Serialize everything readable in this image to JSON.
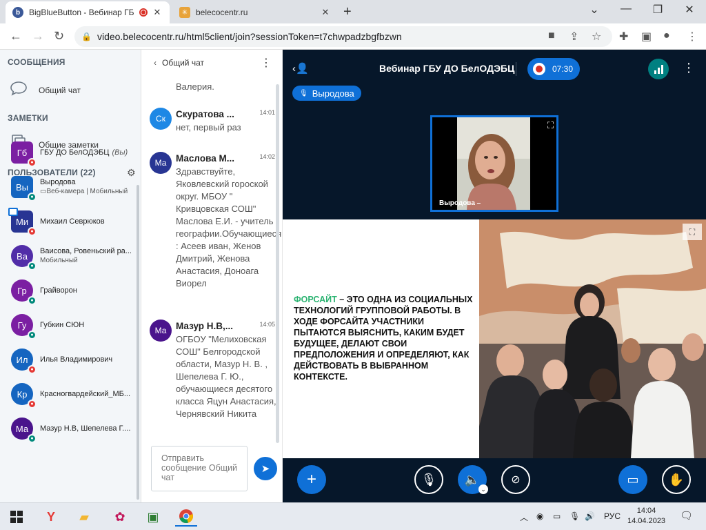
{
  "browser": {
    "tabs": [
      {
        "title": "BigBlueButton - Вебинар ГБ",
        "active": true
      },
      {
        "title": "belecocentr.ru",
        "active": false
      }
    ],
    "url": "video.belecocentr.ru/html5client/join?sessionToken=t7chwpadzbgfbzwn"
  },
  "sidebar": {
    "messages_title": "СООБЩЕНИЯ",
    "public_chat": "Общий чат",
    "notes_title": "ЗАМЕТКИ",
    "shared_notes": "Общие заметки",
    "users_title": "ПОЛЬЗОВАТЕЛИ (22)",
    "users": [
      {
        "initials": "Гб",
        "name": "ГБУ ДО БелОДЭБЦ",
        "suffix": "(Вы)",
        "sub": "",
        "color": "#7b1fa2",
        "mic": "muted",
        "shape": "square"
      },
      {
        "initials": "Вы",
        "name": "Выродова",
        "suffix": "",
        "sub": "▭Веб-камера | Мобильный",
        "color": "#1565c0",
        "mic": "on",
        "shape": "square"
      },
      {
        "initials": "Ми",
        "name": "Михаил Севрюков",
        "suffix": "",
        "sub": "",
        "color": "#283593",
        "mic": "muted",
        "shape": "square"
      },
      {
        "initials": "Ва",
        "name": "Ваисова, Ровеньский ра...",
        "suffix": "",
        "sub": "Мобильный",
        "color": "#512da8",
        "mic": "on",
        "shape": "round"
      },
      {
        "initials": "Гр",
        "name": "Грайворон",
        "suffix": "",
        "sub": "",
        "color": "#7b1fa2",
        "mic": "on",
        "shape": "round"
      },
      {
        "initials": "Гу",
        "name": "Губкин СЮН",
        "suffix": "",
        "sub": "",
        "color": "#7b1fa2",
        "mic": "on",
        "shape": "round"
      },
      {
        "initials": "Ил",
        "name": "Илья Владимирович",
        "suffix": "",
        "sub": "",
        "color": "#1565c0",
        "mic": "muted",
        "shape": "round"
      },
      {
        "initials": "Кр",
        "name": "Красногвардейский_МБ...",
        "suffix": "",
        "sub": "",
        "color": "#1565c0",
        "mic": "muted",
        "shape": "round"
      },
      {
        "initials": "Ма",
        "name": "Мазур Н.В, Шепелева Г....",
        "suffix": "",
        "sub": "",
        "color": "#4a148c",
        "mic": "on",
        "shape": "round"
      }
    ]
  },
  "chat": {
    "title": "Общий чат",
    "partial_top": "Валерия.",
    "messages": [
      {
        "initials": "Ск",
        "name": "Скуратова ...",
        "time": "14:01",
        "text": "нет, первый раз",
        "color": "#1e88e5"
      },
      {
        "initials": "Ма",
        "name": "Маслова М...",
        "time": "14:02",
        "text": "Здравствуйте, Яковлевский гороской округ. МБОУ \" Кривцовская СОШ\" Маслова Е.И. - учитель географии.Обучающиеся : Асеев иван, Женов Дмитрий, Женова Анастасия, Доноага Виорел",
        "color": "#283593"
      },
      {
        "initials": "Ма",
        "name": "Мазур Н.В,...",
        "time": "14:05",
        "text": "ОГБОУ \"Мелиховская СОШ\" Белгородской области, Мазур Н. В. , Шепелева Г. Ю., обучающиеся десятого класса Яцун Анастасия, Чернявский Никита",
        "color": "#4a148c"
      }
    ],
    "input_placeholder": "Отправить сообщение Общий чат"
  },
  "main": {
    "meeting_title": "Вебинар ГБУ ДО БелОДЭБЦ",
    "rec_time": "07:30",
    "talker": "Выродова",
    "webcam_label": "Выродова –",
    "slide_highlight": "Форсайт",
    "slide_text": " – это одна из социальных технологий групповой работы. В ходе форсайта участники пытаются выяснить, каким будет будущее, делают свои предположения и определяют, как действовать в выбранном контексте."
  },
  "taskbar": {
    "lang": "РУС",
    "time": "14:04",
    "date": "14.04.2023"
  }
}
